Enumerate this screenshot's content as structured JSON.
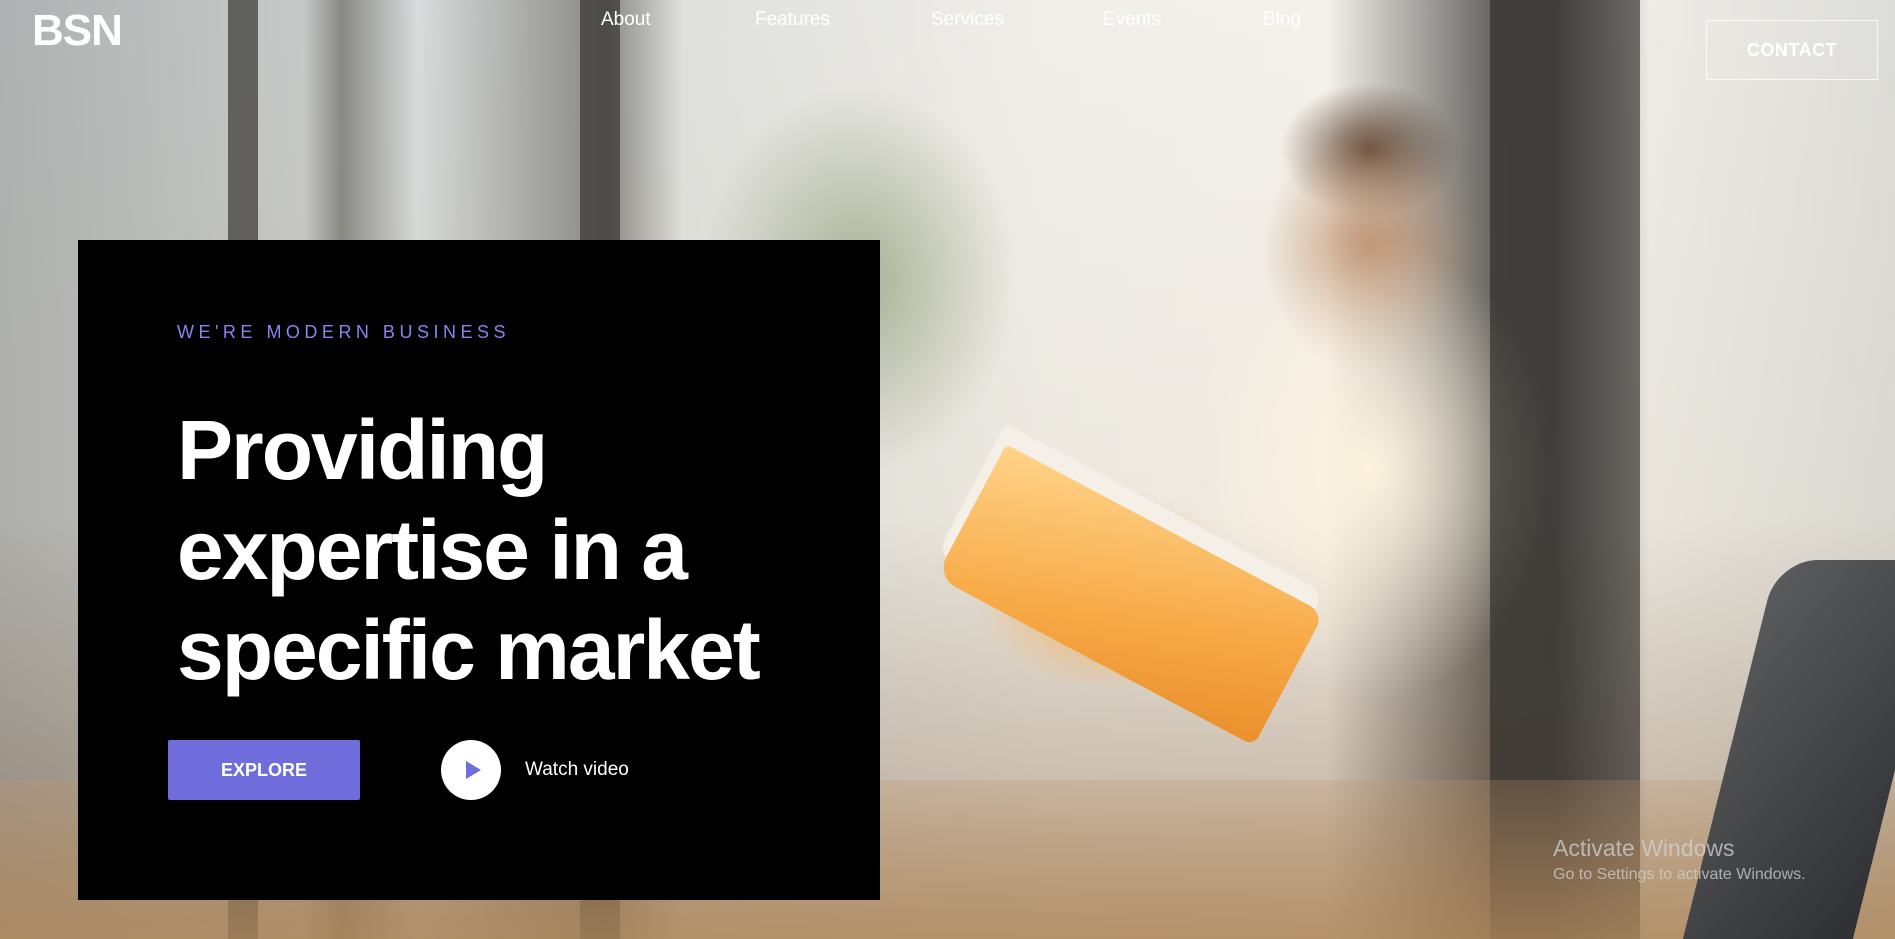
{
  "brand": {
    "logo": "BSN"
  },
  "nav": {
    "items": [
      {
        "label": "About"
      },
      {
        "label": "Features"
      },
      {
        "label": "Services"
      },
      {
        "label": "Events"
      },
      {
        "label": "Blog"
      }
    ],
    "contact_label": "CONTACT"
  },
  "hero": {
    "eyebrow": "WE'RE MODERN BUSINESS",
    "headline_lines": [
      "Providing",
      "expertise in a",
      "specific market"
    ],
    "explore_label": "EXPLORE",
    "watch_label": "Watch video"
  },
  "watermark": {
    "title": "Activate Windows",
    "subtitle": "Go to Settings to activate Windows."
  },
  "colors": {
    "accent": "#6f6ddb",
    "eyebrow": "#8b83f0",
    "hero_panel": "#000000",
    "text": "#ffffff"
  },
  "icons": {
    "play": "play-triangle-icon"
  }
}
